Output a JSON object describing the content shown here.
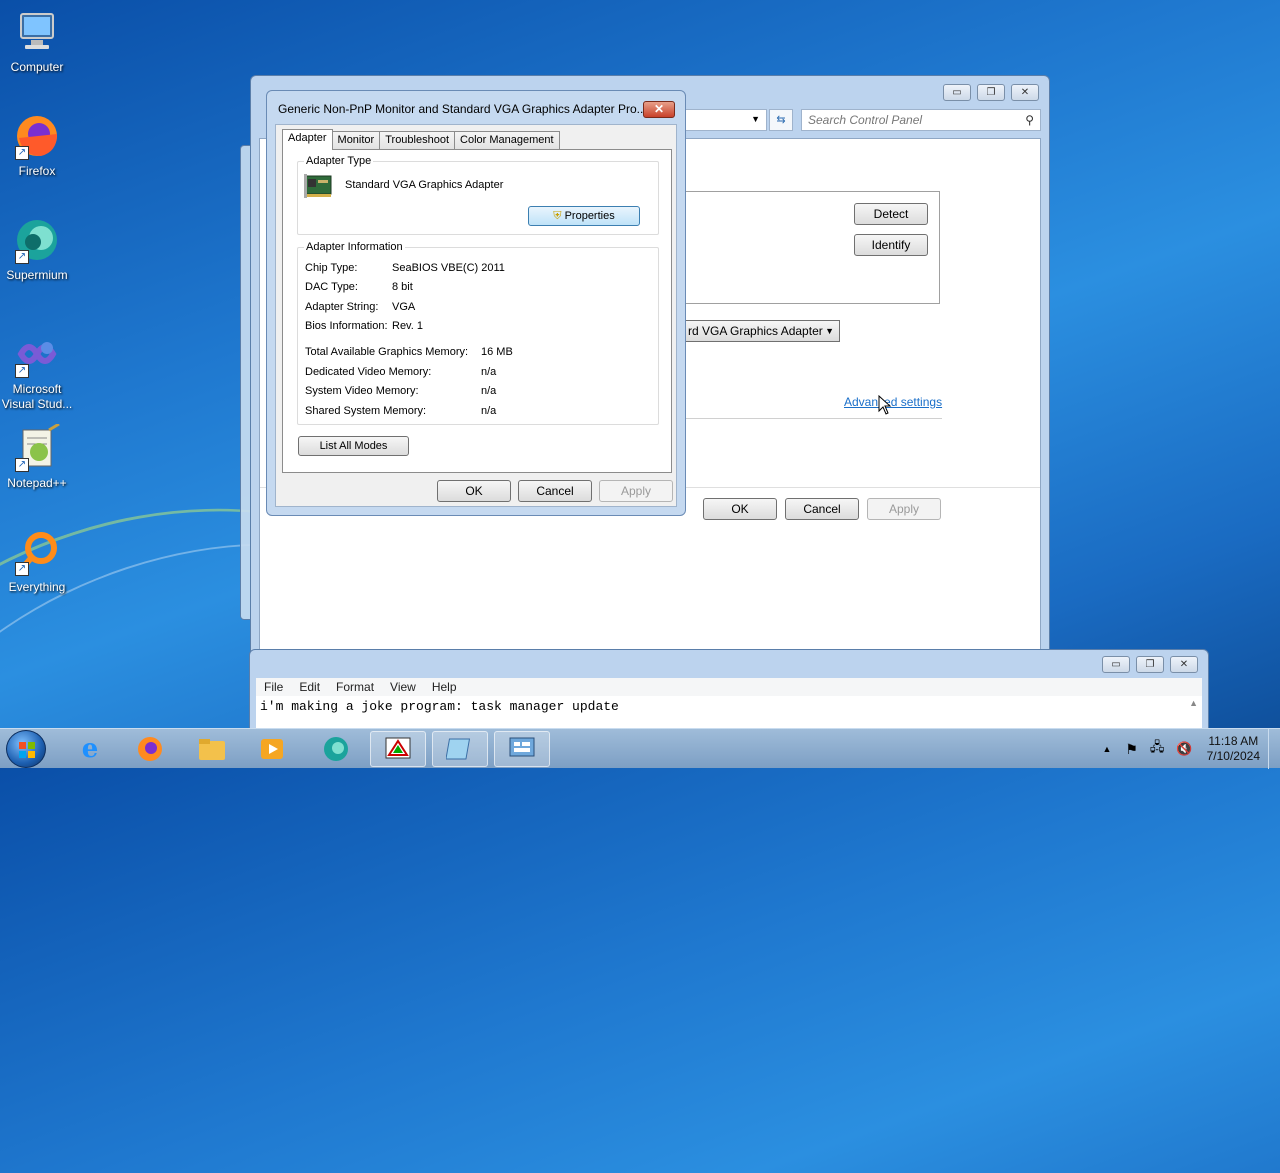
{
  "desktop": {
    "icons": [
      {
        "label": "Computer"
      },
      {
        "label": "Firefox"
      },
      {
        "label": "Supermium"
      },
      {
        "label": "Microsoft Visual Stud..."
      },
      {
        "label": "Notepad++"
      },
      {
        "label": "Everything"
      }
    ]
  },
  "control_panel": {
    "search_placeholder": "Search Control Panel",
    "detect_label": "Detect",
    "identify_label": "Identify",
    "display_dropdown": "rd VGA Graphics Adapter",
    "advanced_link": "Advanced settings",
    "ok_label": "OK",
    "cancel_label": "Cancel",
    "apply_label": "Apply"
  },
  "dialog": {
    "title": "Generic Non-PnP Monitor and Standard VGA Graphics Adapter Pro...",
    "close_glyph": "✕",
    "tabs": [
      {
        "label": "Adapter"
      },
      {
        "label": "Monitor"
      },
      {
        "label": "Troubleshoot"
      },
      {
        "label": "Color Management"
      }
    ],
    "adapter_type_heading": "Adapter Type",
    "adapter_name": "Standard VGA Graphics Adapter",
    "properties_label": "Properties",
    "adapter_info_heading": "Adapter Information",
    "info_rows": [
      {
        "label": "Chip Type:",
        "value": "SeaBIOS VBE(C) 2011"
      },
      {
        "label": "DAC Type:",
        "value": "8 bit"
      },
      {
        "label": "Adapter String:",
        "value": "VGA"
      },
      {
        "label": "Bios Information:",
        "value": "Rev. 1"
      }
    ],
    "memory_rows": [
      {
        "label": "Total Available Graphics Memory:",
        "value": "16 MB"
      },
      {
        "label": "Dedicated Video Memory:",
        "value": "n/a"
      },
      {
        "label": "System Video Memory:",
        "value": "n/a"
      },
      {
        "label": "Shared System Memory:",
        "value": "n/a"
      }
    ],
    "list_modes_label": "List All Modes",
    "ok_label": "OK",
    "cancel_label": "Cancel",
    "apply_label": "Apply"
  },
  "notepad": {
    "menu": [
      "File",
      "Edit",
      "Format",
      "View",
      "Help"
    ],
    "text": "i'm making a joke program: task manager update"
  },
  "taskbar": {
    "time": "11:18 AM",
    "date": "7/10/2024"
  }
}
